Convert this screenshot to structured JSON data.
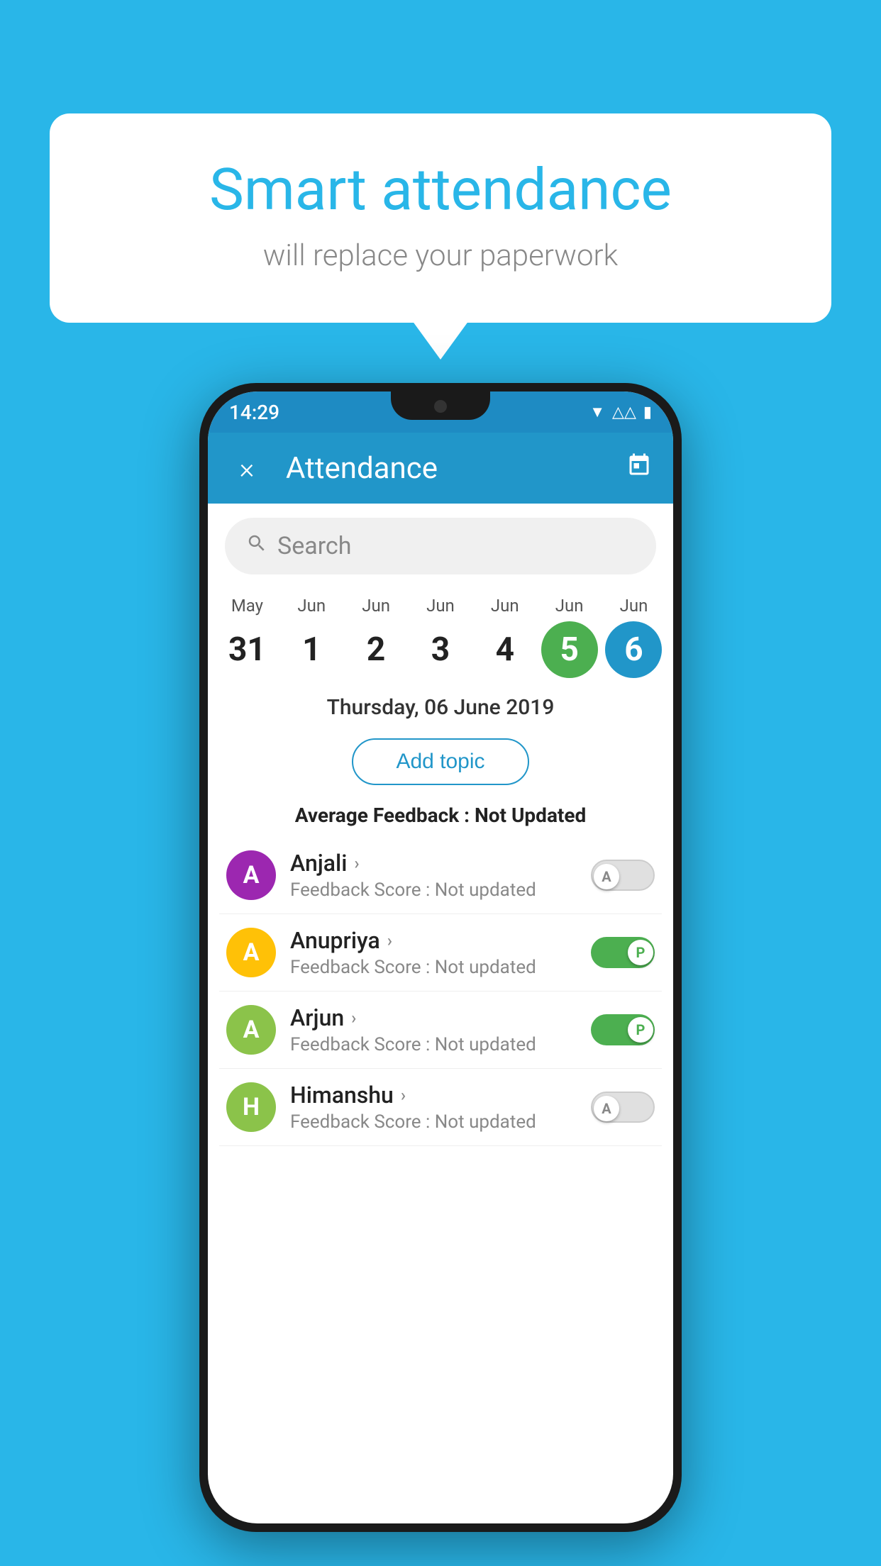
{
  "background_color": "#29B6E8",
  "bubble": {
    "title": "Smart attendance",
    "subtitle": "will replace your paperwork"
  },
  "status_bar": {
    "time": "14:29",
    "wifi": "▲",
    "signal": "▲",
    "battery": "▮"
  },
  "header": {
    "title": "Attendance",
    "close_label": "×",
    "calendar_icon": "📅"
  },
  "search": {
    "placeholder": "Search"
  },
  "calendar": {
    "days": [
      {
        "month": "May",
        "num": "31",
        "state": "normal"
      },
      {
        "month": "Jun",
        "num": "1",
        "state": "normal"
      },
      {
        "month": "Jun",
        "num": "2",
        "state": "normal"
      },
      {
        "month": "Jun",
        "num": "3",
        "state": "normal"
      },
      {
        "month": "Jun",
        "num": "4",
        "state": "normal"
      },
      {
        "month": "Jun",
        "num": "5",
        "state": "today"
      },
      {
        "month": "Jun",
        "num": "6",
        "state": "selected"
      }
    ]
  },
  "selected_date": "Thursday, 06 June 2019",
  "add_topic_label": "Add topic",
  "avg_feedback_label": "Average Feedback :",
  "avg_feedback_value": "Not Updated",
  "students": [
    {
      "name": "Anjali",
      "avatar_letter": "A",
      "avatar_color": "#9C27B0",
      "feedback": "Feedback Score : Not updated",
      "toggle": "off",
      "toggle_letter": "A"
    },
    {
      "name": "Anupriya",
      "avatar_letter": "A",
      "avatar_color": "#FFC107",
      "feedback": "Feedback Score : Not updated",
      "toggle": "on",
      "toggle_letter": "P"
    },
    {
      "name": "Arjun",
      "avatar_letter": "A",
      "avatar_color": "#8BC34A",
      "feedback": "Feedback Score : Not updated",
      "toggle": "on",
      "toggle_letter": "P"
    },
    {
      "name": "Himanshu",
      "avatar_letter": "H",
      "avatar_color": "#8BC34A",
      "feedback": "Feedback Score : Not updated",
      "toggle": "off",
      "toggle_letter": "A"
    }
  ]
}
